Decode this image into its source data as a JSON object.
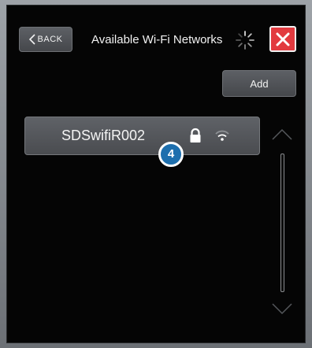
{
  "header": {
    "back_label": "BACK",
    "title": "Available Wi-Fi Networks"
  },
  "toolbar": {
    "add_label": "Add"
  },
  "networks": [
    {
      "ssid": "SDSwifiR002",
      "secured": true,
      "icons": [
        "lock-icon",
        "wifi-signal-icon"
      ]
    }
  ],
  "annotation": {
    "step_number": "4"
  },
  "colors": {
    "close_button": "#e23a3f",
    "badge": "#1d6fae",
    "button_bg": "#54575b",
    "background": "#121314"
  },
  "icons": {
    "back": "chevron-left-icon",
    "loading": "spinner-icon",
    "close": "close-icon",
    "scroll_up": "chevron-up-icon",
    "scroll_down": "chevron-down-icon"
  }
}
